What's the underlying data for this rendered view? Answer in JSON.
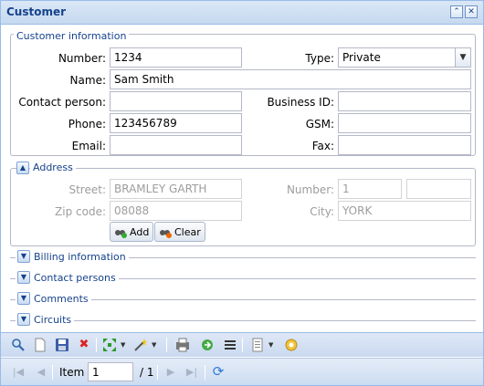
{
  "window": {
    "title": "Customer"
  },
  "customer_info": {
    "legend": "Customer information",
    "number_label": "Number:",
    "number_value": "1234",
    "type_label": "Type:",
    "type_value": "Private",
    "name_label": "Name:",
    "name_value": "Sam Smith",
    "contact_label": "Contact person:",
    "contact_value": "",
    "business_label": "Business ID:",
    "business_value": "",
    "phone_label": "Phone:",
    "phone_value": "123456789",
    "gsm_label": "GSM:",
    "gsm_value": "",
    "email_label": "Email:",
    "email_value": "",
    "fax_label": "Fax:",
    "fax_value": ""
  },
  "address": {
    "legend": "Address",
    "street_label": "Street:",
    "street_value": "BRAMLEY GARTH",
    "number_label": "Number:",
    "number_value": "1",
    "number_value2": "",
    "zip_label": "Zip code:",
    "zip_value": "08088",
    "city_label": "City:",
    "city_value": "YORK",
    "add_label": "Add",
    "clear_label": "Clear"
  },
  "sections": [
    "Billing information",
    "Contact persons",
    "Comments",
    "Circuits"
  ],
  "paging": {
    "item_label": "Item",
    "item_value": "1",
    "total": "/ 1"
  },
  "icons": {
    "title_buttons": [
      "collapse-icon",
      "close-icon"
    ],
    "toolbar": [
      "search-icon",
      "new-document-icon",
      "save-icon",
      "delete-icon",
      "expand-icon",
      "wand-icon",
      "print-icon",
      "export-icon",
      "list-icon",
      "report-icon",
      "settings-icon"
    ],
    "paging": [
      "first-page-icon",
      "prev-page-icon",
      "next-page-icon",
      "last-page-icon",
      "refresh-icon"
    ]
  }
}
